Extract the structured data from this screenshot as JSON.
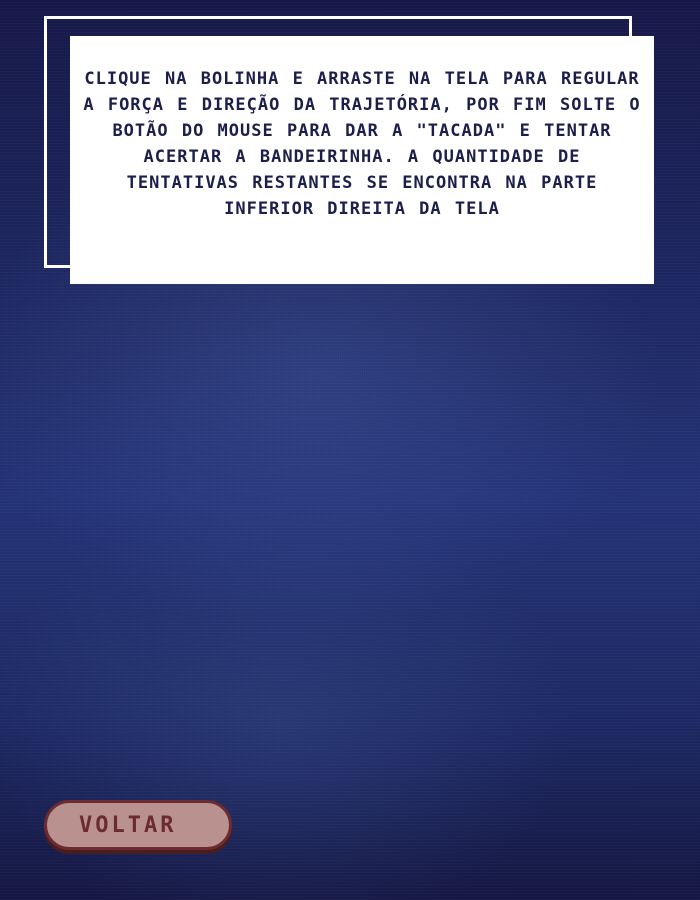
{
  "instructions": {
    "text": "CLIQUE NA BOLINHA E ARRASTE NA TELA PARA REGULAR A FORÇA E DIREÇÃO DA TRAJETÓRIA, POR FIM SOLTE O BOTÃO DO MOUSE PARA DAR A \"TACADA\" E TENTAR ACERTAR A BANDEIRINHA. A QUANTIDADE DE TENTATIVAS RESTANTES SE ENCONTRA NA PARTE INFERIOR DIREITA DA TELA"
  },
  "back_button": {
    "label": "VOLTAR"
  },
  "colors": {
    "background": "#1f2a66",
    "panel": "#ffffff",
    "panel_text": "#1b1f4a",
    "button_fill": "#b9928f",
    "button_border": "#6b2b30"
  }
}
